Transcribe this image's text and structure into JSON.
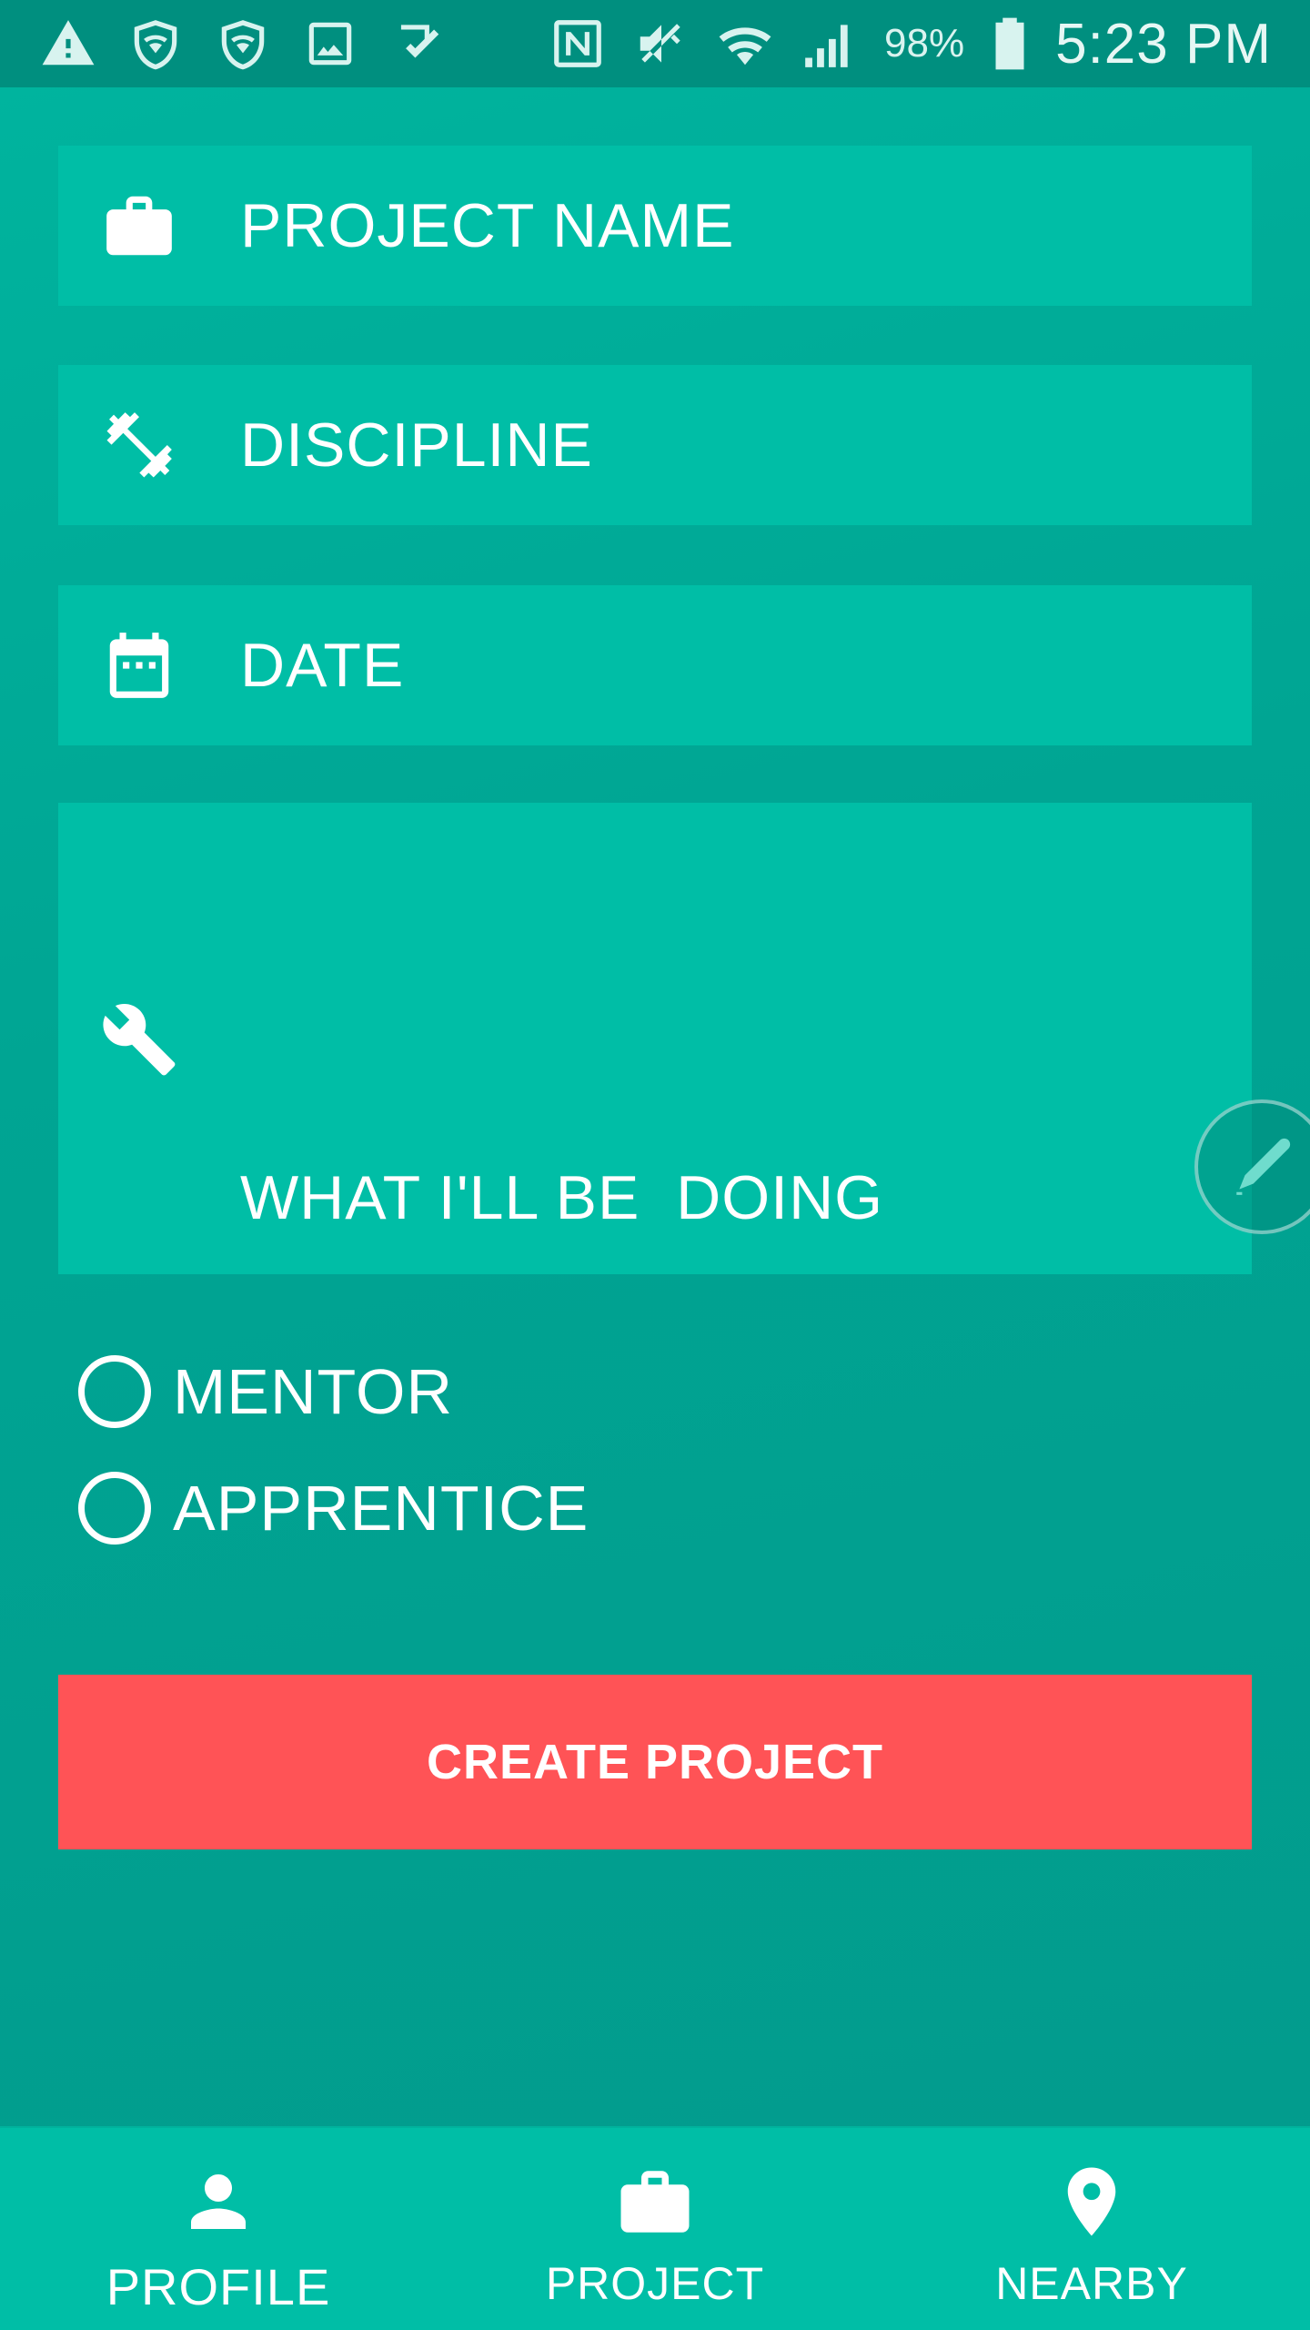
{
  "status_bar": {
    "battery": "98%",
    "time": "5:23 PM",
    "left_icons": [
      "warning-icon",
      "shield-wifi-icon",
      "shield-wifi-icon",
      "image-icon",
      "checkmark-icon"
    ],
    "right_icons": [
      "nfc-icon",
      "mute-icon",
      "wifi-icon",
      "signal-icon",
      "battery-icon"
    ]
  },
  "form": {
    "project_name": {
      "label": "PROJECT NAME",
      "icon": "briefcase-icon"
    },
    "discipline": {
      "label": "DISCIPLINE",
      "icon": "fitness-icon"
    },
    "date": {
      "label": "DATE",
      "icon": "calendar-icon"
    },
    "doing": {
      "label": "WHAT I'LL BE  DOING",
      "icon": "wrench-icon"
    },
    "roles": [
      {
        "label": "MENTOR",
        "selected": false
      },
      {
        "label": "APPRENTICE",
        "selected": false
      }
    ],
    "submit_label": "CREATE PROJECT"
  },
  "nav": {
    "items": [
      {
        "label": "PROFILE",
        "icon": "person-icon"
      },
      {
        "label": "PROJECT",
        "icon": "briefcase-icon"
      },
      {
        "label": "NEARBY",
        "icon": "location-pin-icon"
      }
    ]
  },
  "colors": {
    "background": "#00a593",
    "field": "#00bea6",
    "status_bar": "#008f7f",
    "button": "#ff5356",
    "text": "#ffffff"
  }
}
